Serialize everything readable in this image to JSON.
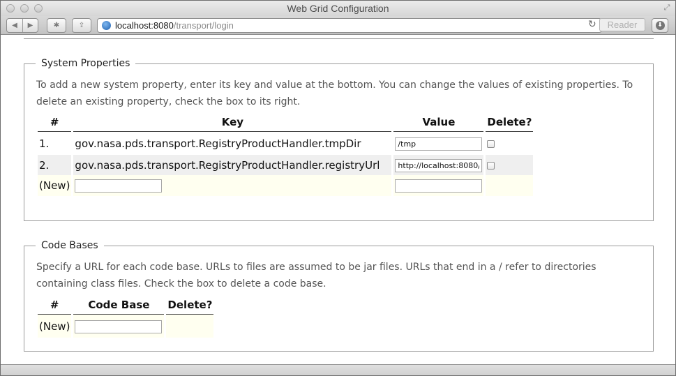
{
  "window": {
    "title": "Web Grid Configuration"
  },
  "toolbar": {
    "url_host": "localhost:8080",
    "url_path": "/transport/login",
    "reader_label": "Reader"
  },
  "system_properties": {
    "legend": "System Properties",
    "description": "To add a new system property, enter its key and value at the bottom. You can change the values of existing properties. To delete an existing property, check the box to its right.",
    "headers": {
      "num": "#",
      "key": "Key",
      "value": "Value",
      "delete": "Delete?"
    },
    "rows": [
      {
        "num": "1.",
        "key": "gov.nasa.pds.transport.RegistryProductHandler.tmpDir",
        "value": "/tmp"
      },
      {
        "num": "2.",
        "key": "gov.nasa.pds.transport.RegistryProductHandler.registryUrl",
        "value": "http://localhost:8080/"
      }
    ],
    "new_label": "(New)"
  },
  "code_bases": {
    "legend": "Code Bases",
    "description": "Specify a URL for each code base. URLs to files are assumed to be jar files. URLs that end in a / refer to directories containing class files. Check the box to delete a code base.",
    "headers": {
      "num": "#",
      "code_base": "Code Base",
      "delete": "Delete?"
    },
    "new_label": "(New)"
  }
}
